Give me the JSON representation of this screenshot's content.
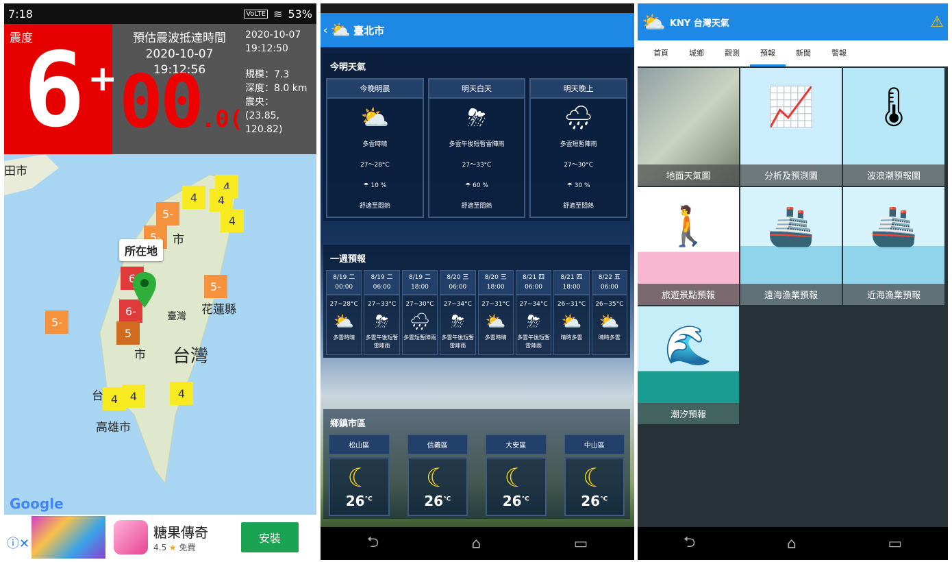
{
  "screen1": {
    "status": {
      "time": "7:18",
      "volte": "VoLTE",
      "battery": "53%"
    },
    "intensity_label": "震度",
    "intensity_value": "6",
    "intensity_plus": "+",
    "eta_title": "預估震波抵達時間",
    "eta_time": "2020-10-07 19:12:56",
    "countdown": "00",
    "countdown_dec": ".0(",
    "info": {
      "date": "2020-10-07",
      "time": "19:12:50",
      "magnitude": "規模：7.3",
      "depth": "深度：8.0 km",
      "epicenter_label": "震央：",
      "epicenter_lat": "(23.85,",
      "epicenter_lon": "120.82)"
    },
    "map": {
      "place_labels": [
        "田市",
        "市",
        "臺灣",
        "花蓮縣",
        "台灣",
        "市",
        "台南",
        "高雄市"
      ],
      "location_pin": "所在地",
      "markers": [
        "4",
        "4",
        "4",
        "4",
        "5-",
        "5-",
        "5-",
        "5-",
        "6",
        "6-",
        "5",
        "4",
        "4",
        "4"
      ],
      "google": "Google"
    },
    "ad": {
      "title": "糖果傳奇",
      "rating": "4.5",
      "free": "免費",
      "install": "安裝"
    }
  },
  "screen2": {
    "top_title": "臺北市",
    "today": {
      "title": "今明天氣",
      "cols": [
        {
          "head": "今晚明晨",
          "desc": "多雲時晴",
          "temp": "27～28°C",
          "rain": "10 %",
          "feel": "舒適至悶熱"
        },
        {
          "head": "明天白天",
          "desc": "多雲午後短暫雷陣雨",
          "temp": "27～33°C",
          "rain": "60 %",
          "feel": "舒適至悶熱"
        },
        {
          "head": "明天晚上",
          "desc": "多雲短暫陣雨",
          "temp": "27～30°C",
          "rain": "30 %",
          "feel": "舒適至悶熱"
        }
      ]
    },
    "week": {
      "title": "一週預報",
      "cols": [
        {
          "date": "8/19 二",
          "time": "00:00",
          "temp": "27~28°C",
          "desc": "多雲時晴"
        },
        {
          "date": "8/19 二",
          "time": "06:00",
          "temp": "27~33°C",
          "desc": "多雲午後短暫雷陣雨"
        },
        {
          "date": "8/19 二",
          "time": "18:00",
          "temp": "27~30°C",
          "desc": "多雲短暫陣雨"
        },
        {
          "date": "8/20 三",
          "time": "06:00",
          "temp": "27~34°C",
          "desc": "多雲午後短暫雷陣雨"
        },
        {
          "date": "8/20 三",
          "time": "18:00",
          "temp": "27~31°C",
          "desc": "多雲時晴"
        },
        {
          "date": "8/21 四",
          "time": "06:00",
          "temp": "27~34°C",
          "desc": "多雲午後短暫雷陣雨"
        },
        {
          "date": "8/21 四",
          "time": "18:00",
          "temp": "26~31°C",
          "desc": "晴時多雲"
        },
        {
          "date": "8/22 五",
          "time": "06:00",
          "temp": "26~35°C",
          "desc": "晴時多雲"
        }
      ]
    },
    "district": {
      "title": "鄉鎮市區",
      "cols": [
        {
          "name": "松山區",
          "temp": "26"
        },
        {
          "name": "信義區",
          "temp": "26"
        },
        {
          "name": "大安區",
          "temp": "26"
        },
        {
          "name": "中山區",
          "temp": "26"
        }
      ]
    }
  },
  "screen3": {
    "app_title": "KNY 台灣天氣",
    "tabs": [
      "首頁",
      "城鄉",
      "觀測",
      "預報",
      "新聞",
      "警報"
    ],
    "active_tab": "預報",
    "tiles": [
      "地面天氣圖",
      "分析及預測圖",
      "波浪潮預報圖",
      "旅遊景點預報",
      "遠海漁業預報",
      "近海漁業預報",
      "潮汐預報"
    ]
  },
  "icons": {
    "back": "←",
    "home": "⌂",
    "recent": "▭",
    "sun_cloud": "⛅",
    "rain": "🌧",
    "moon": "☾"
  },
  "colors": {
    "red": "#e60000",
    "blue": "#1e88e5",
    "green": "#1aa353"
  }
}
